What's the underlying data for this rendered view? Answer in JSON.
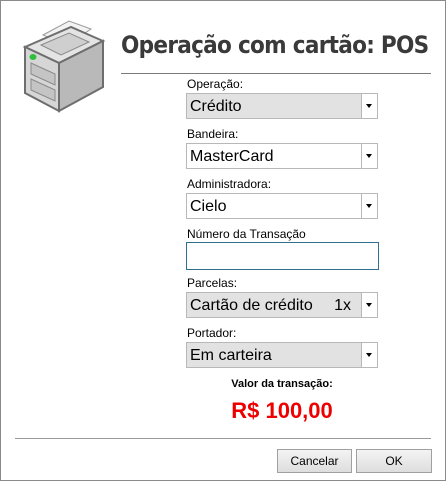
{
  "dialog": {
    "title": "Operação com cartão: POS",
    "icon": "pos-printer-icon"
  },
  "fields": {
    "operacao": {
      "label": "Operação:",
      "value": "Crédito"
    },
    "bandeira": {
      "label": "Bandeira:",
      "value": "MasterCard"
    },
    "administradora": {
      "label": "Administradora:",
      "value": "Cielo"
    },
    "numero_transacao": {
      "label": "Número da Transação",
      "value": ""
    },
    "parcelas": {
      "label": "Parcelas:",
      "value": "Cartão de crédito",
      "installments": "1x"
    },
    "portador": {
      "label": "Portador:",
      "value": "Em carteira"
    }
  },
  "valor": {
    "label": "Valor da transação:",
    "amount": "R$ 100,00",
    "color": "#ee0000"
  },
  "buttons": {
    "cancel_label": "Cancelar",
    "ok_label": "OK"
  }
}
